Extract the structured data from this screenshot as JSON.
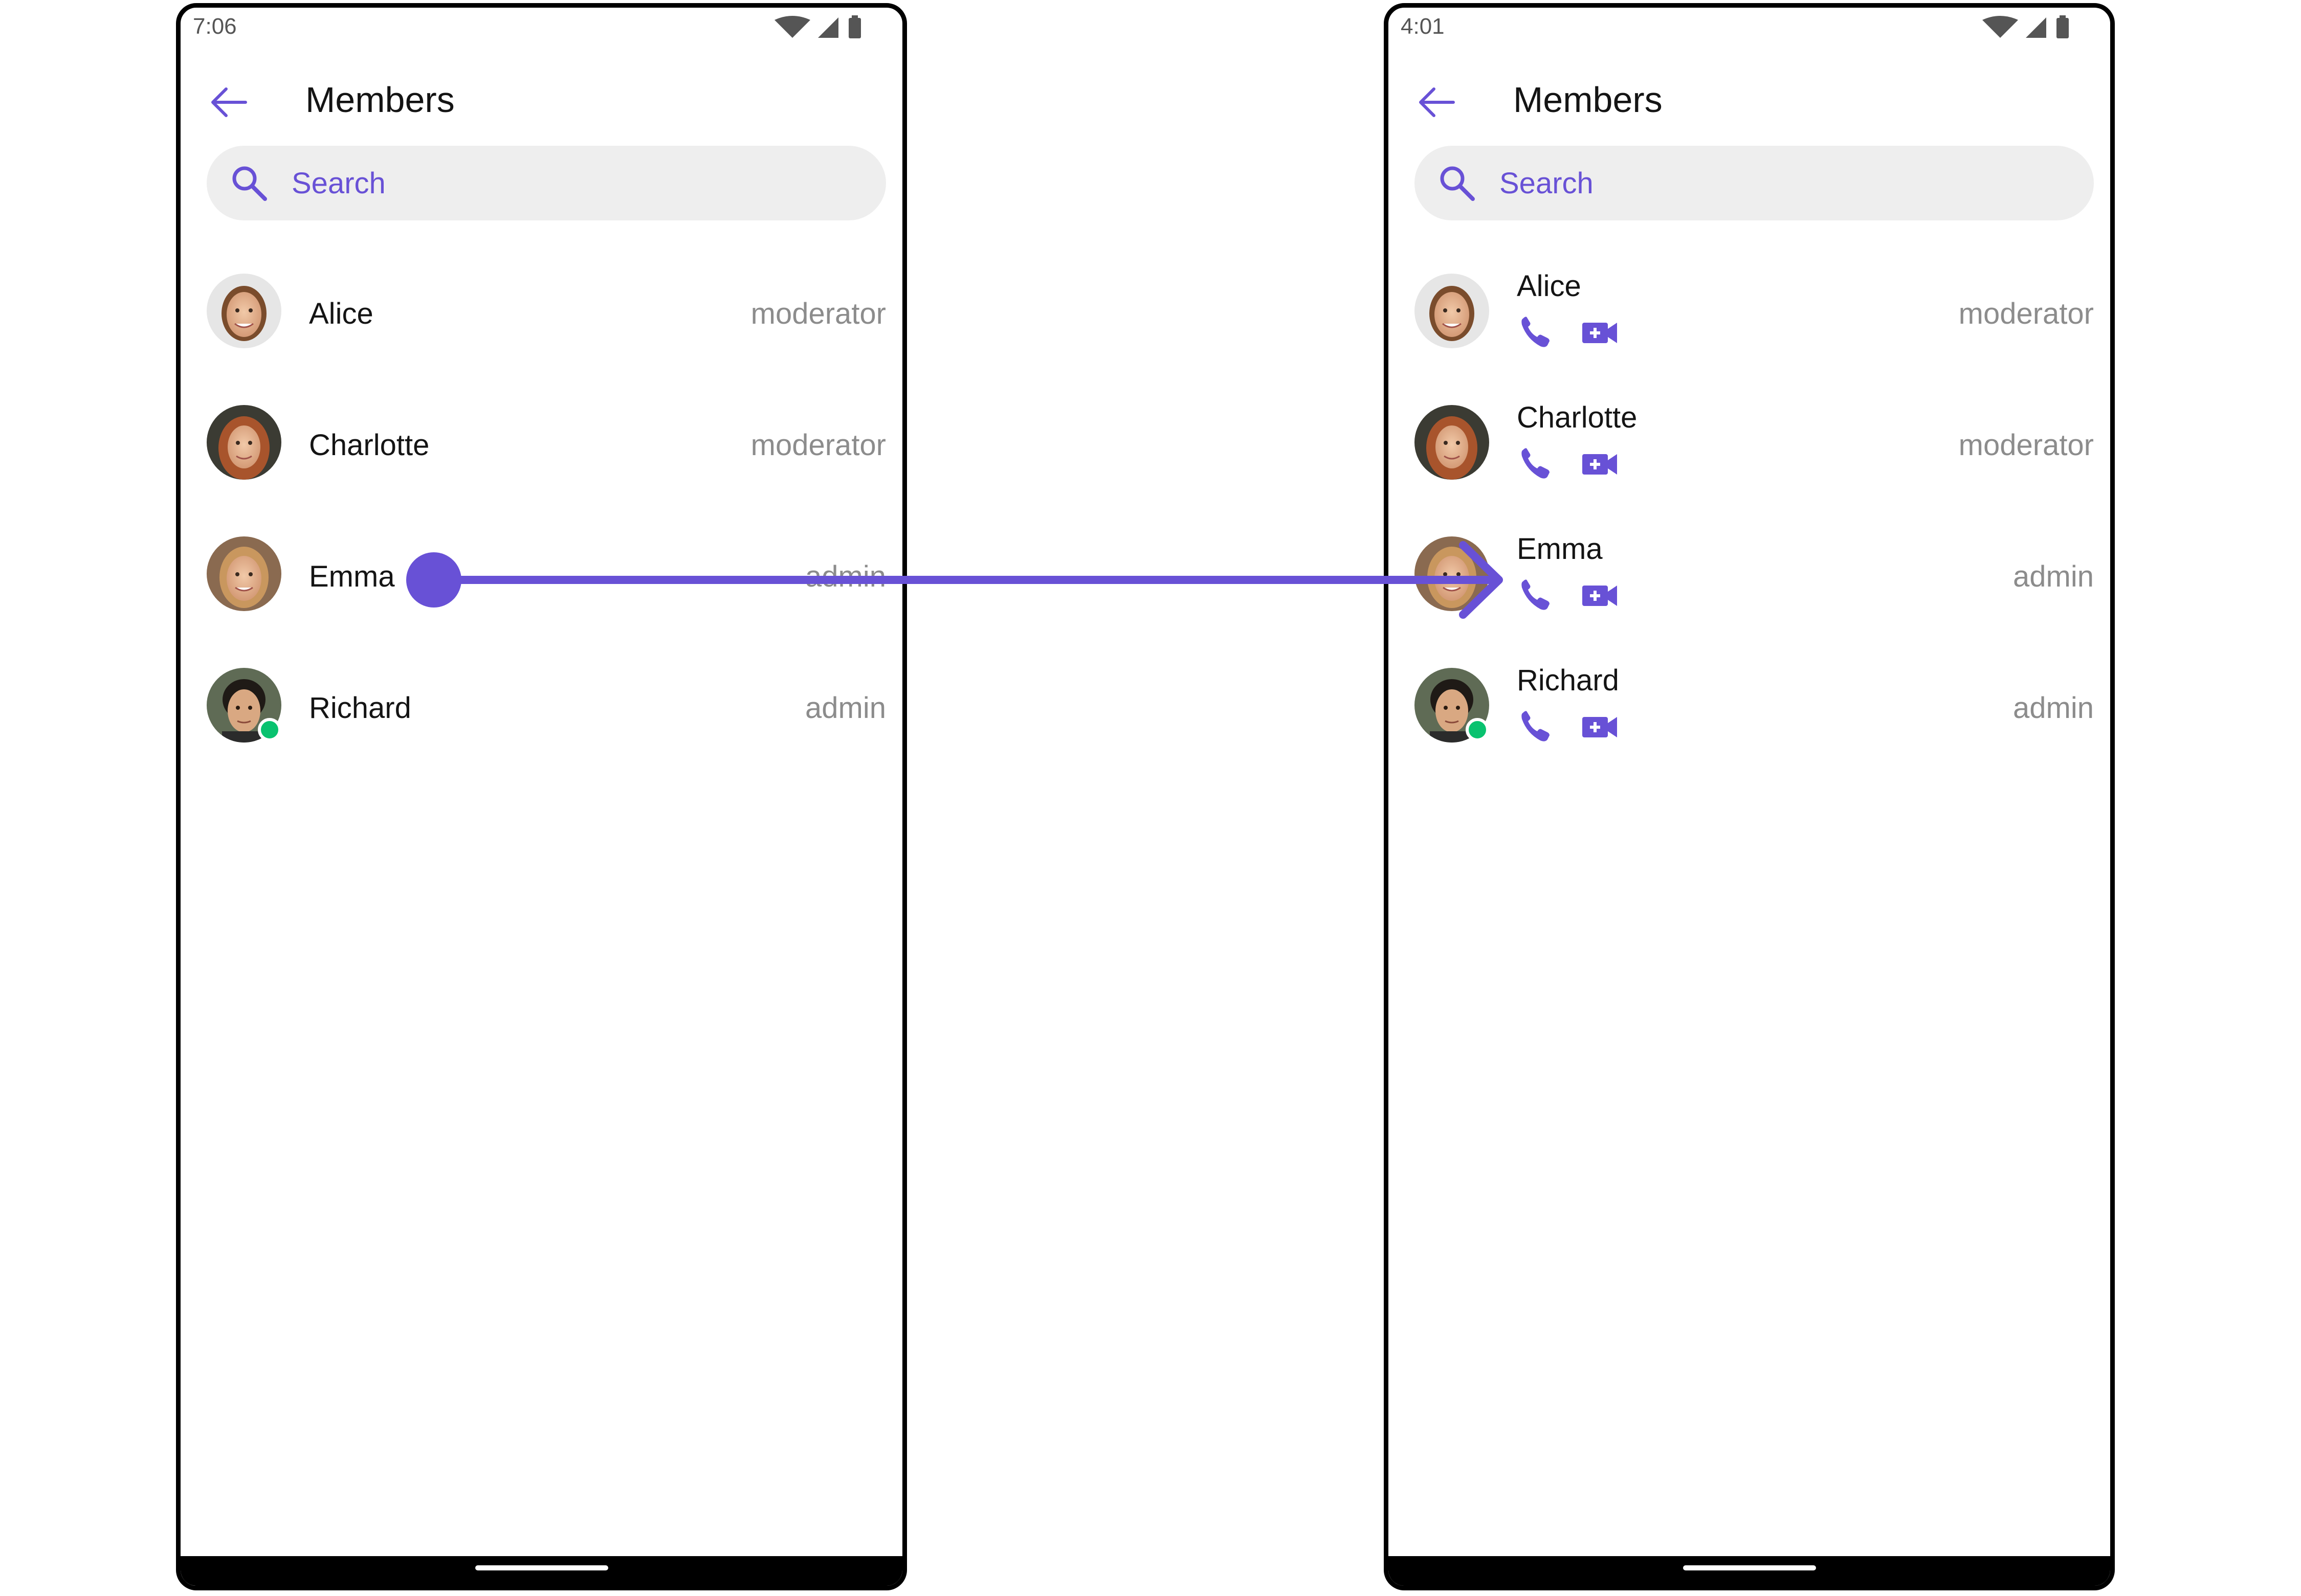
{
  "accent_color": "#6851D6",
  "presence_color": "#09C26F",
  "screens": [
    {
      "status": {
        "time": "7:06",
        "icons": [
          "wifi-icon",
          "signal-icon",
          "battery-icon"
        ]
      },
      "appbar": {
        "title": "Members",
        "back_icon": "arrow-left-icon"
      },
      "search": {
        "placeholder": "Search",
        "value": ""
      },
      "members": [
        {
          "name": "Alice",
          "role": "moderator",
          "online": false
        },
        {
          "name": "Charlotte",
          "role": "moderator",
          "online": false
        },
        {
          "name": "Emma",
          "role": "admin",
          "online": false
        },
        {
          "name": "Richard",
          "role": "admin",
          "online": true
        }
      ]
    },
    {
      "status": {
        "time": "4:01",
        "icons": [
          "wifi-icon",
          "signal-icon",
          "battery-icon"
        ]
      },
      "appbar": {
        "title": "Members",
        "back_icon": "arrow-left-icon"
      },
      "search": {
        "placeholder": "Search",
        "value": ""
      },
      "members": [
        {
          "name": "Alice",
          "role": "moderator",
          "online": false,
          "actions": [
            "phone-icon",
            "video-call-icon"
          ]
        },
        {
          "name": "Charlotte",
          "role": "moderator",
          "online": false,
          "actions": [
            "phone-icon",
            "video-call-icon"
          ]
        },
        {
          "name": "Emma",
          "role": "admin",
          "online": false,
          "actions": [
            "phone-icon",
            "video-call-icon"
          ]
        },
        {
          "name": "Richard",
          "role": "admin",
          "online": true,
          "actions": [
            "phone-icon",
            "video-call-icon"
          ]
        }
      ]
    }
  ],
  "gesture": {
    "type": "swipe-right",
    "from_member": "Emma",
    "color": "#6851D6"
  }
}
